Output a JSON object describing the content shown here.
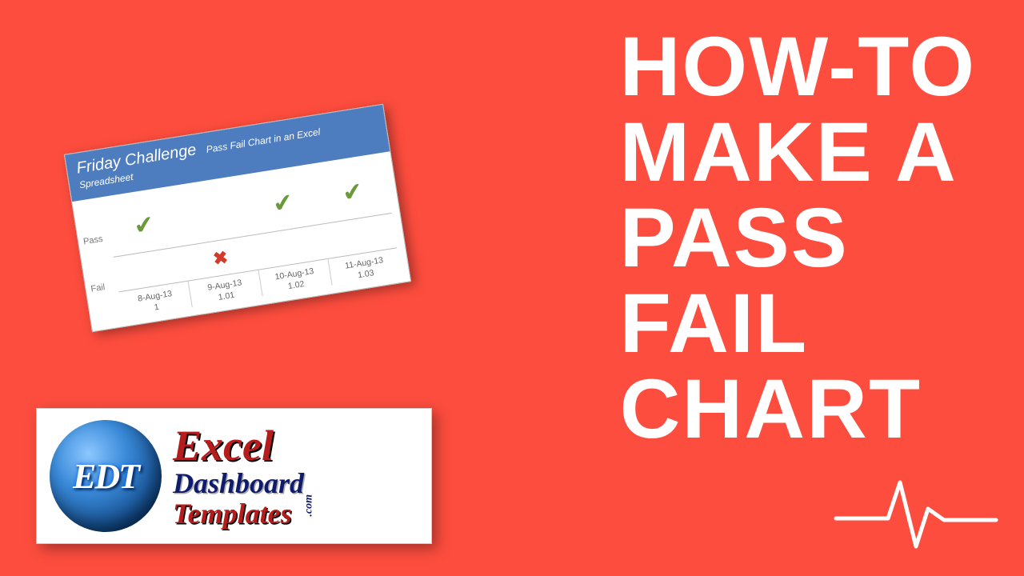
{
  "title_line1": "HOW-TO",
  "title_line2": "MAKE A",
  "title_line3": "PASS",
  "title_line4": "FAIL",
  "title_line5": "CHART",
  "card": {
    "header_main": "Friday Challenge",
    "header_sub": "Pass Fail Chart in an Excel Spreadsheet",
    "y_pass": "Pass",
    "y_fail": "Fail"
  },
  "chart_data": {
    "type": "scatter",
    "categories": [
      "8-Aug-13",
      "9-Aug-13",
      "10-Aug-13",
      "11-Aug-13"
    ],
    "secondary_values": [
      1,
      1.01,
      1.02,
      1.03
    ],
    "status": [
      "pass",
      "fail",
      "pass",
      "pass"
    ],
    "y_levels": [
      "Fail",
      "Pass"
    ],
    "title": "Friday Challenge  Pass Fail Chart in an Excel Spreadsheet"
  },
  "logo": {
    "monogram": "EDT",
    "line1": "Excel",
    "line2": "Dashboard",
    "line3": "Templates",
    "dotcom": ".com"
  }
}
